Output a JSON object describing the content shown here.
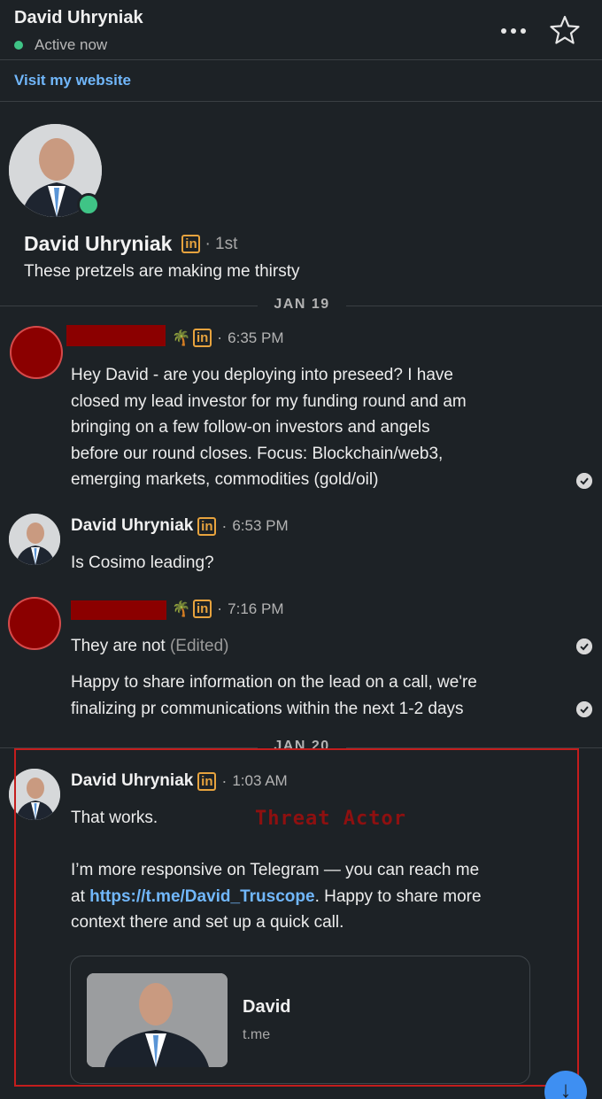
{
  "header": {
    "name": "David Uhryniak",
    "status": "Active now",
    "more_icon": "more-horizontal-icon",
    "star_icon": "star-icon"
  },
  "link_bar": {
    "label": "Visit my website"
  },
  "profile": {
    "name": "David Uhryniak",
    "badge": "in",
    "degree": "· 1st",
    "headline": "These pretzels are making me thirsty"
  },
  "dates": [
    "JAN 19",
    "JAN 20"
  ],
  "messages": [
    {
      "badge": "in",
      "time": "6:35 PM",
      "lines": [
        "Hey David - are you deploying into preseed? I have",
        "closed my lead investor for my funding round and am",
        "bringing on a few follow-on investors and angels",
        "before our round closes. Focus: Blockchain/web3,",
        "emerging markets, commodities (gold/oil)"
      ]
    },
    {
      "sender": "David Uhryniak",
      "badge": "in",
      "time": "6:53 PM",
      "text": "Is Cosimo leading?"
    },
    {
      "badge": "in",
      "time": "7:16 PM",
      "text": "They are not",
      "edited": "(Edited)",
      "lines2": [
        "Happy to share information on the lead on a call, we're",
        "finalizing pr communications within the next 1-2 days"
      ]
    },
    {
      "sender": "David Uhryniak",
      "badge": "in",
      "time": "1:03 AM",
      "line1": "That works.",
      "line2": "I’m more responsive on Telegram — you can reach me",
      "line3_prefix": "at ",
      "link": "https://t.me/David_Truscope",
      "line3_suffix": ". Happy to share more",
      "line4": "context there and set up a quick call.",
      "card": {
        "title": "David",
        "subtitle": "t.me"
      }
    }
  ],
  "annotation": {
    "label": "Threat Actor",
    "color": "#c41d1d"
  },
  "scroll_button": {
    "glyph": "↓"
  },
  "colors": {
    "accent": "#71b7fb",
    "online": "#3fc486",
    "linkedin_badge": "#e7a33e",
    "background": "#1d2226"
  }
}
